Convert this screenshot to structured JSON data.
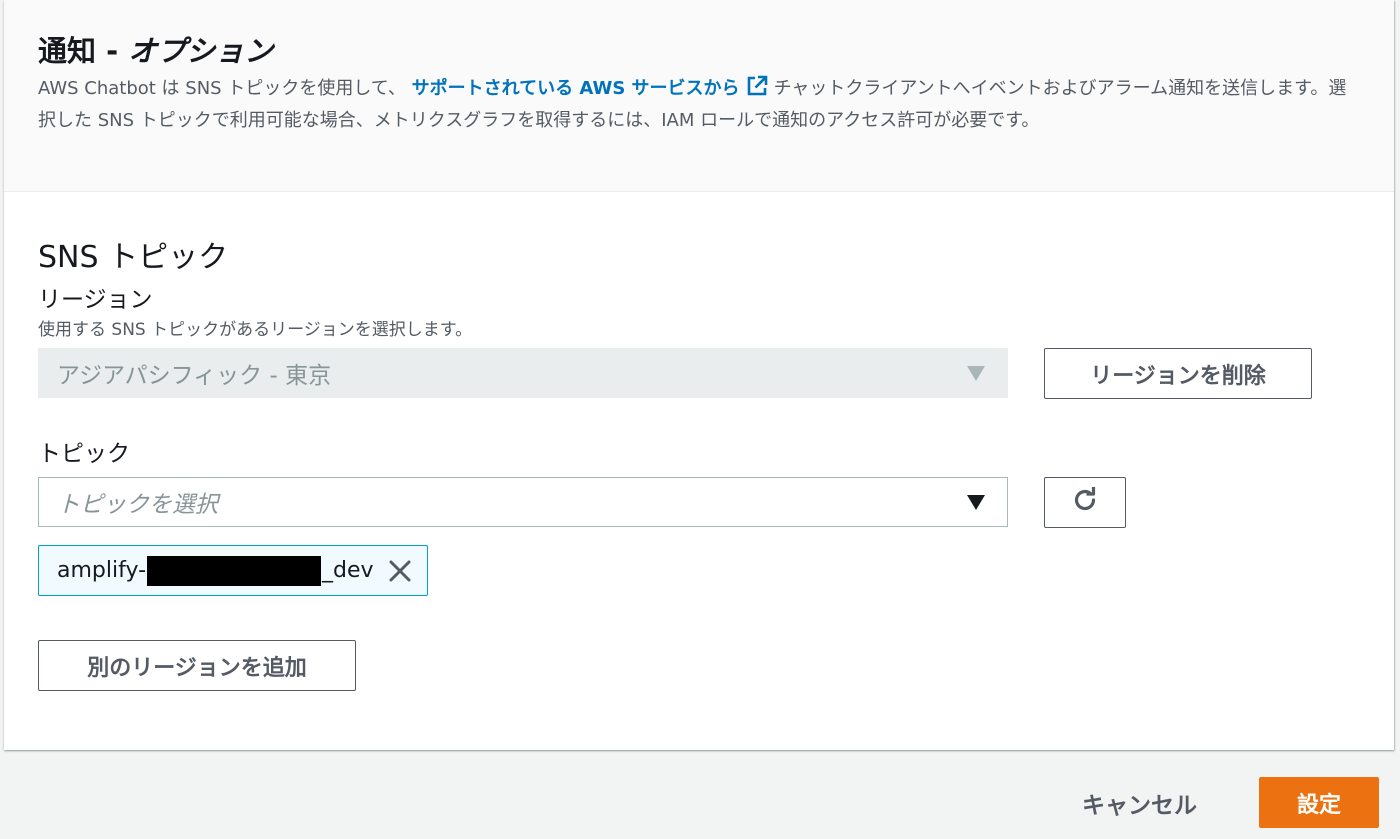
{
  "header": {
    "title_prefix": "通知 - ",
    "title_italic": "オプション",
    "desc_part1": "AWS Chatbot は SNS トピックを使用して、",
    "desc_link": "サポートされている AWS サービスから",
    "desc_part2": "チャットクライアントへイベントおよびアラーム通知を送信します。選択した SNS トピックで利用可能な場合、メトリクスグラフを取得するには、IAM ロールで通知のアクセス許可が必要です。"
  },
  "sns": {
    "section_title": "SNS トピック",
    "region_label": "リージョン",
    "region_desc": "使用する SNS トピックがあるリージョンを選択します。",
    "region_value": "アジアパシフィック - 東京",
    "remove_region_label": "リージョンを削除",
    "topic_label": "トピック",
    "topic_placeholder": "トピックを選択",
    "token_prefix": "amplify-",
    "token_suffix": "_dev",
    "add_region_label": "別のリージョンを追加"
  },
  "footer": {
    "cancel_label": "キャンセル",
    "submit_label": "設定"
  },
  "colors": {
    "link": "#0073bb",
    "primary": "#ec7211",
    "token_border": "#00a1c9"
  },
  "icons": [
    "external-link-icon",
    "refresh-icon",
    "close-icon",
    "caret-down-icon"
  ]
}
